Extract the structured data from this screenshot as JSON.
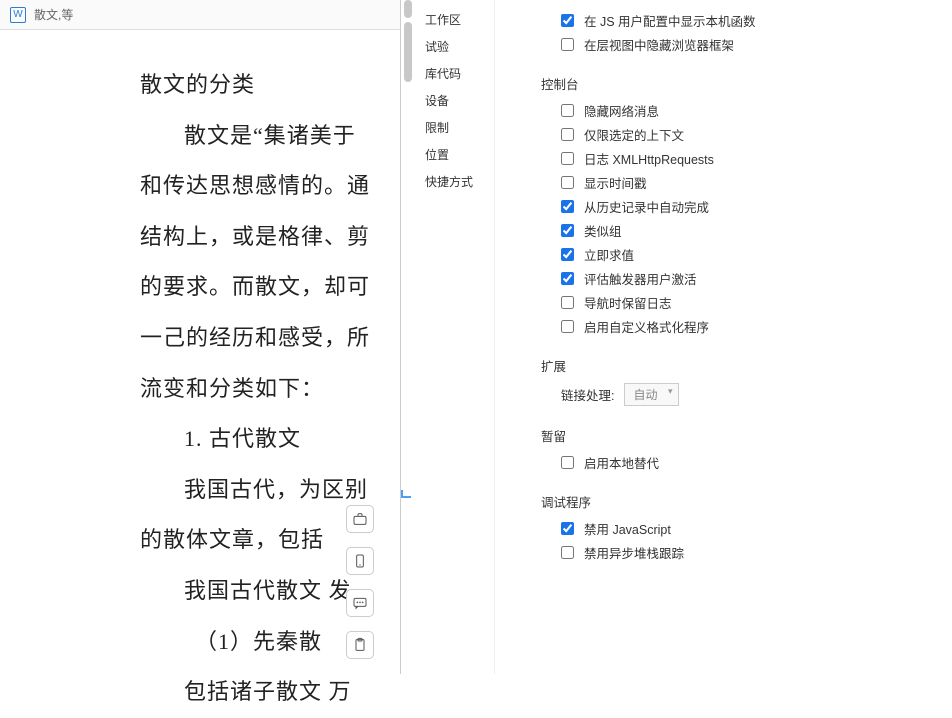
{
  "doc": {
    "tab_title": "散文,等",
    "lines": [
      "散文的分类",
      "散文是“集诸美于",
      "和传达思想感情的。通",
      "结构上，或是格律、剪",
      "的要求。而散文，却可",
      "一己的经历和感受，所",
      "流变和分类如下：",
      "1. 古代散文",
      "我国古代，为区别",
      "的散体文章，包括",
      "我国古代散文   发",
      "（1）先秦散",
      "包括诸子散文   万"
    ]
  },
  "side_icons": [
    "briefcase-icon",
    "mobile-icon",
    "chat-icon",
    "clipboard-icon"
  ],
  "dev": {
    "sidebar": [
      "工作区",
      "试验",
      "库代码",
      "设备",
      "限制",
      "位置",
      "快捷方式"
    ],
    "top_section": {
      "options": [
        {
          "label": "在 JS 用户配置中显示本机函数",
          "checked": true
        },
        {
          "label": "在层视图中隐藏浏览器框架",
          "checked": false
        }
      ]
    },
    "sections": [
      {
        "title": "控制台",
        "options": [
          {
            "label": "隐藏网络消息",
            "checked": false
          },
          {
            "label": "仅限选定的上下文",
            "checked": false
          },
          {
            "label": "日志 XMLHttpRequests",
            "checked": false
          },
          {
            "label": "显示时间戳",
            "checked": false
          },
          {
            "label": "从历史记录中自动完成",
            "checked": true
          },
          {
            "label": "类似组",
            "checked": true
          },
          {
            "label": "立即求值",
            "checked": true
          },
          {
            "label": "评估触发器用户激活",
            "checked": true
          },
          {
            "label": "导航时保留日志",
            "checked": false
          },
          {
            "label": "启用自定义格式化程序",
            "checked": false
          }
        ]
      },
      {
        "title": "扩展",
        "select": {
          "label": "链接处理:",
          "value": "自动"
        }
      },
      {
        "title": "暂留",
        "options": [
          {
            "label": "启用本地替代",
            "checked": false
          }
        ]
      },
      {
        "title": "调试程序",
        "options": [
          {
            "label": "禁用 JavaScript",
            "checked": true
          },
          {
            "label": "禁用异步堆栈跟踪",
            "checked": false
          }
        ]
      }
    ]
  }
}
